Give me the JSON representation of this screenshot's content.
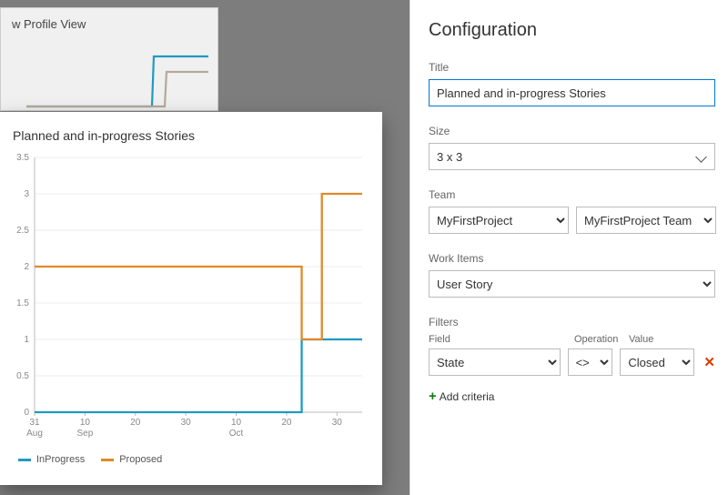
{
  "bg_card": {
    "title": "w Profile View"
  },
  "preview": {
    "title": "Planned and in-progress Stories"
  },
  "chart_data": {
    "type": "line",
    "title": "Planned and in-progress Stories",
    "xlabel": "",
    "ylabel": "",
    "ylim": [
      0,
      3.5
    ],
    "y_ticks": [
      0,
      0.5,
      1,
      1.5,
      2,
      2.5,
      3,
      3.5
    ],
    "x_categories": [
      "31 Aug",
      "10 Sep",
      "20",
      "30",
      "10 Oct",
      "20",
      "30"
    ],
    "x_positions": [
      0,
      10,
      20,
      30,
      40,
      50,
      60
    ],
    "series": [
      {
        "name": "InProgress",
        "color": "#1f9bbf",
        "points": [
          {
            "x": 0,
            "y": 0
          },
          {
            "x": 52,
            "y": 0
          },
          {
            "x": 53,
            "y": 1
          },
          {
            "x": 65,
            "y": 1
          }
        ]
      },
      {
        "name": "Proposed",
        "color": "#e08a2a",
        "points": [
          {
            "x": 0,
            "y": 2
          },
          {
            "x": 50,
            "y": 2
          },
          {
            "x": 53,
            "y": 1
          },
          {
            "x": 56,
            "y": 1
          },
          {
            "x": 57,
            "y": 3
          },
          {
            "x": 65,
            "y": 3
          }
        ]
      }
    ]
  },
  "legend": {
    "items": [
      {
        "label": "InProgress",
        "color": "#1f9bbf"
      },
      {
        "label": "Proposed",
        "color": "#e08a2a"
      }
    ]
  },
  "panel": {
    "heading": "Configuration",
    "title_label": "Title",
    "title_value": "Planned and in-progress Stories",
    "size_label": "Size",
    "size_value": "3 x 3",
    "team_label": "Team",
    "team_project": "MyFirstProject",
    "team_name": "MyFirstProject Team",
    "workitems_label": "Work Items",
    "workitems_value": "User Story",
    "filters_label": "Filters",
    "filters_cols": {
      "field": "Field",
      "operation": "Operation",
      "value": "Value"
    },
    "filter_row": {
      "field": "State",
      "operation": "<>",
      "value": "Closed"
    },
    "add_criteria": "Add criteria"
  }
}
